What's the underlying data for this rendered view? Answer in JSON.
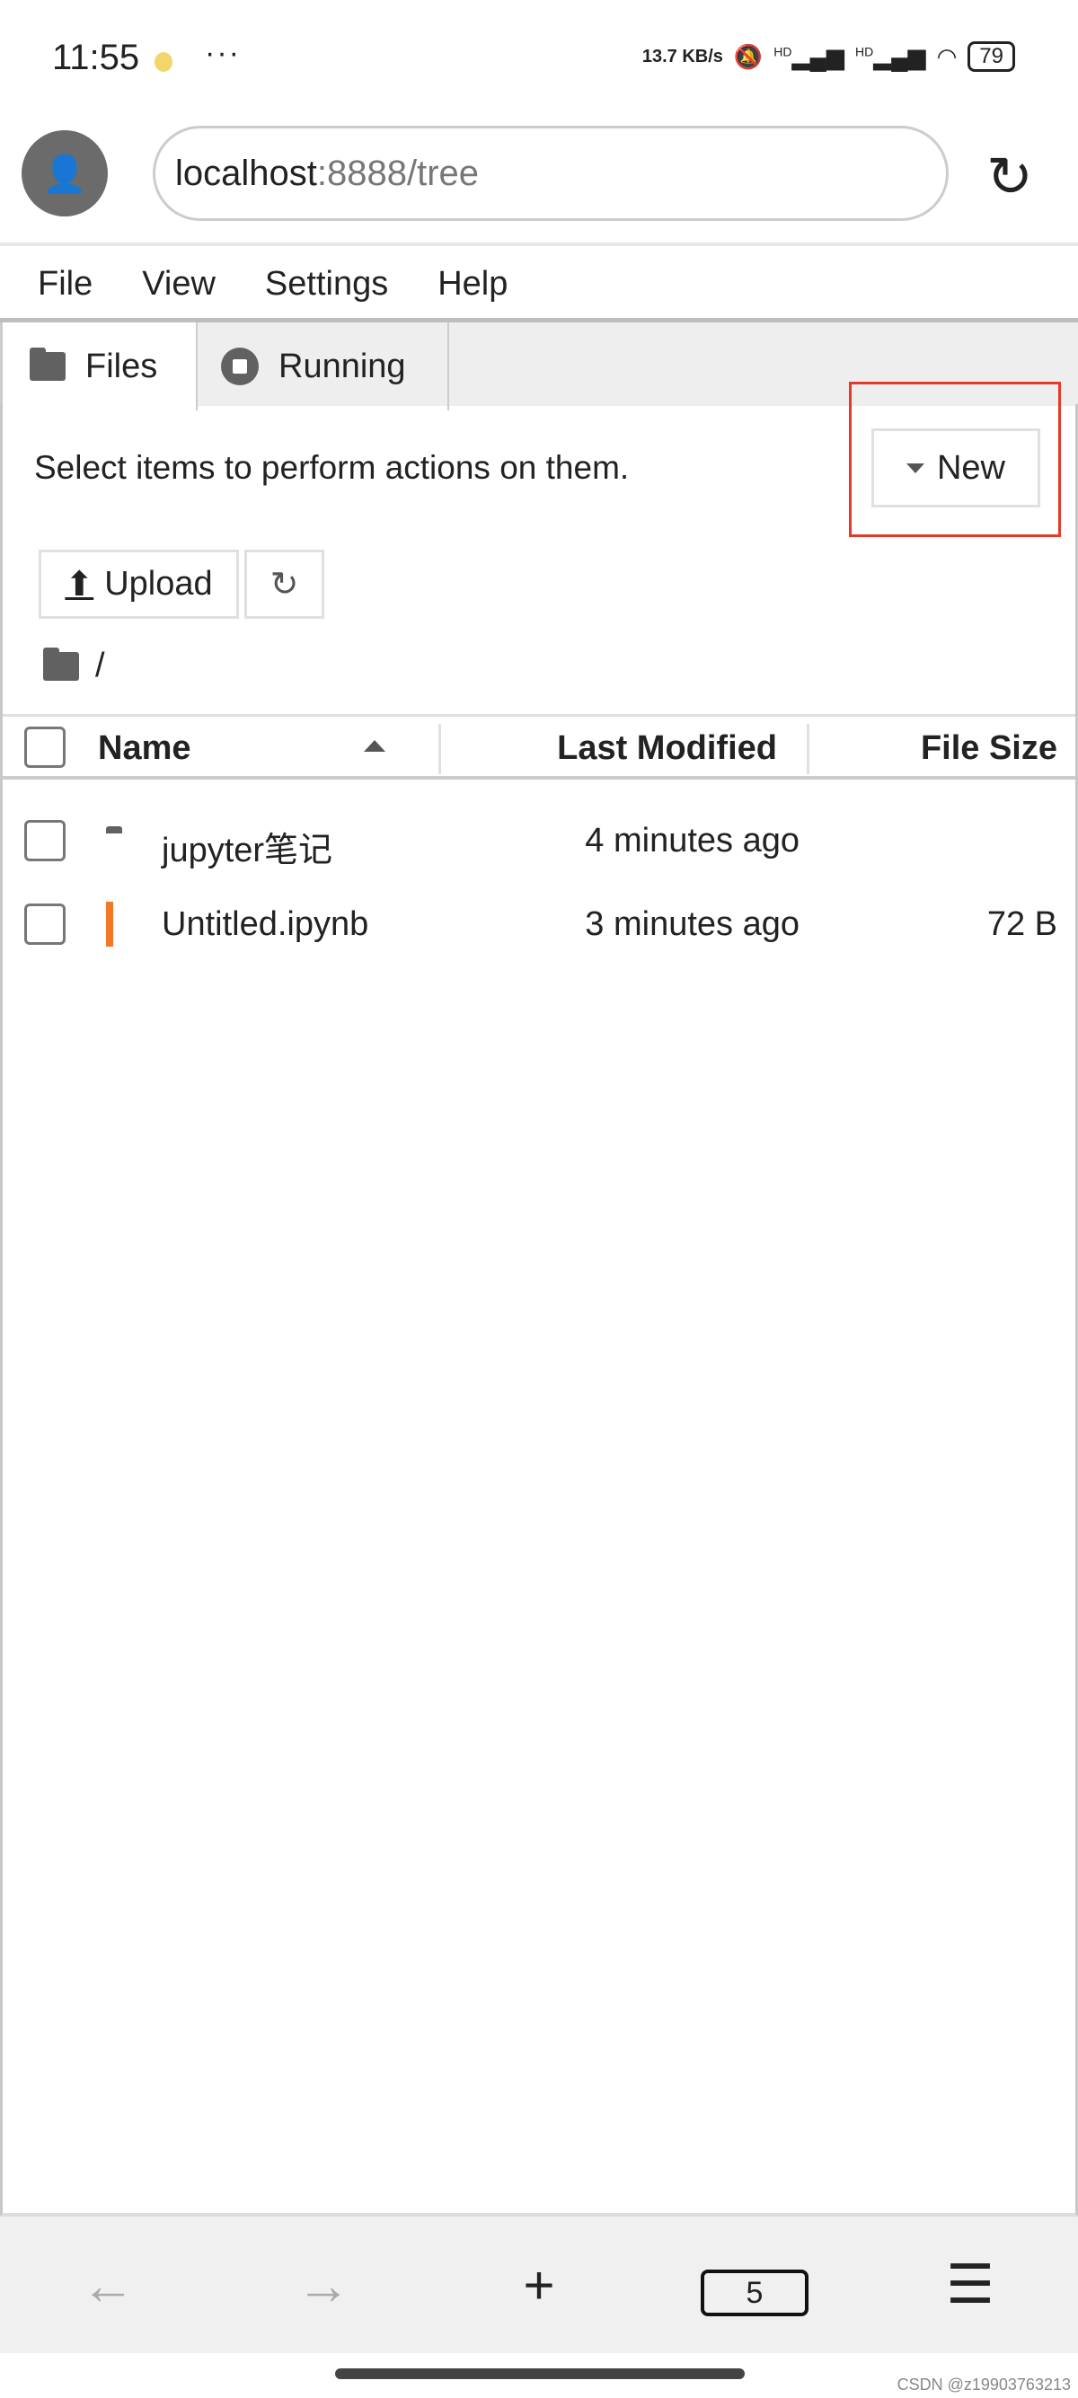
{
  "status_bar": {
    "time": "11:55",
    "more": "···",
    "net_speed": "13.7 KB/s",
    "signal1": "HD",
    "signal2": "HD",
    "battery": "79"
  },
  "browser": {
    "url_host": "localhost",
    "url_rest": ":8888/tree"
  },
  "menu": [
    "File",
    "View",
    "Settings",
    "Help"
  ],
  "tabs": [
    {
      "label": "Files",
      "active": true
    },
    {
      "label": "Running",
      "active": false
    }
  ],
  "toolbar": {
    "hint": "Select items to perform actions on them.",
    "new_label": "New",
    "upload_label": "Upload"
  },
  "breadcrumb": "/",
  "table": {
    "headers": {
      "name": "Name",
      "modified": "Last Modified",
      "size": "File Size"
    },
    "rows": [
      {
        "name": "jupyter笔记",
        "type": "folder",
        "modified": "4 minutes ago",
        "size": ""
      },
      {
        "name": "Untitled.ipynb",
        "type": "notebook",
        "modified": "3 minutes ago",
        "size": "72 B"
      }
    ]
  },
  "bottom_nav": {
    "tab_count": "5"
  },
  "watermark": "CSDN @z19903763213",
  "colors": {
    "highlight_box": "#e53a2b",
    "notebook_icon": "#f37726"
  }
}
